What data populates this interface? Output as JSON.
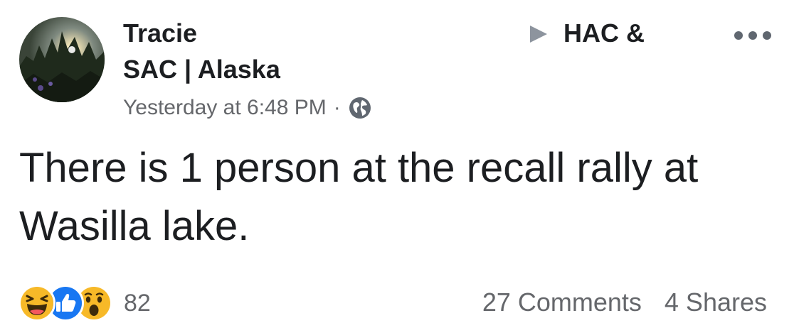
{
  "post": {
    "author_line1": "Tracie",
    "author_line2": "SAC | Alaska",
    "group_name": "HAC &",
    "timestamp": "Yesterday at 6:48 PM",
    "separator": "·",
    "privacy_icon": "globe-icon",
    "text": "There is 1 person at the recall rally at Wasilla lake.",
    "more_icon": "more-options-icon",
    "arrow_icon": "triangle-right-icon"
  },
  "reactions": {
    "icons": [
      "haha-icon",
      "like-icon",
      "wow-icon"
    ],
    "count": "82"
  },
  "engagement": {
    "comments": "27 Comments",
    "shares": "4 Shares"
  },
  "colors": {
    "text_primary": "#1c1e21",
    "text_secondary": "#65676b",
    "like_blue": "#1877f2",
    "reaction_yellow": "#f7b928"
  }
}
